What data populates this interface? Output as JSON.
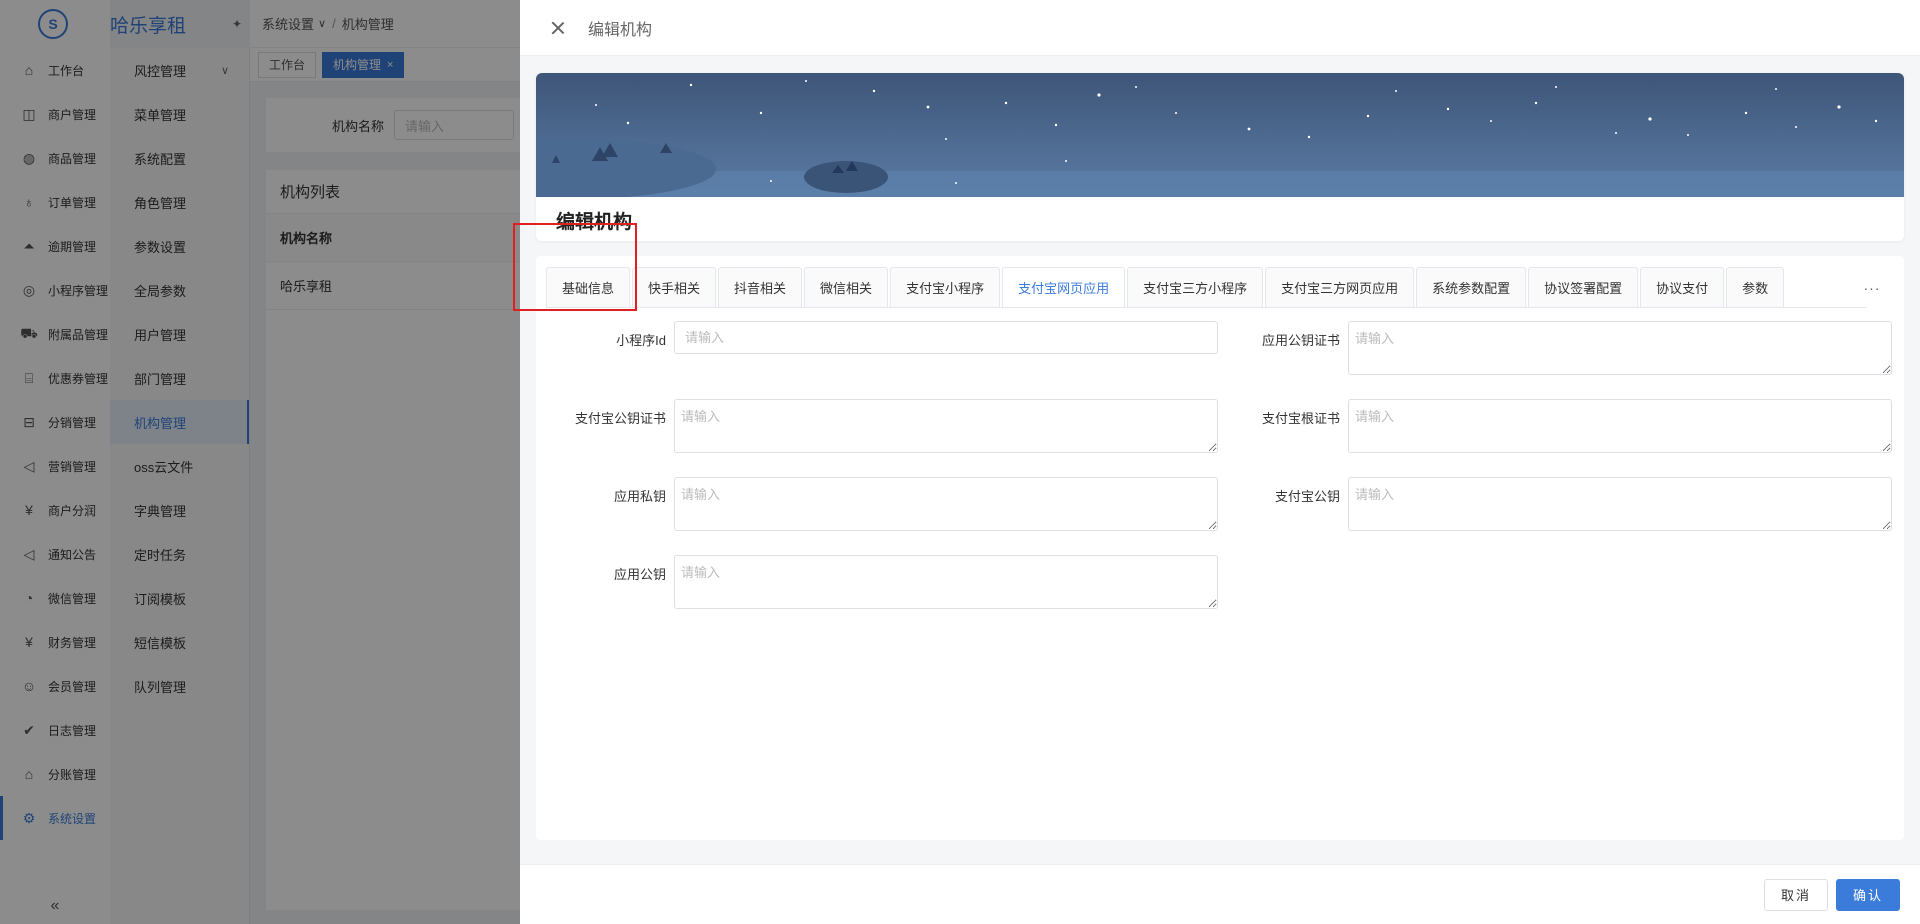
{
  "app": {
    "brand": "哈乐享租",
    "logo_glyph": "S",
    "sidebar": [
      {
        "label": "工作台",
        "icon": "home-icon",
        "glyph": "⌂"
      },
      {
        "label": "商户管理",
        "icon": "shopping-bag-icon",
        "glyph": "◫"
      },
      {
        "label": "商品管理",
        "icon": "apple-icon",
        "glyph": "◍"
      },
      {
        "label": "订单管理",
        "icon": "trophy-icon",
        "glyph": "♁"
      },
      {
        "label": "逾期管理",
        "icon": "alarm-icon",
        "glyph": "⏶"
      },
      {
        "label": "小程序管理",
        "icon": "robot-icon",
        "glyph": "◎"
      },
      {
        "label": "附属品管理",
        "icon": "cart-icon",
        "glyph": "⛟"
      },
      {
        "label": "优惠券管理",
        "icon": "gift-icon",
        "glyph": "⌸"
      },
      {
        "label": "分销管理",
        "icon": "sliders-icon",
        "glyph": "⊟"
      },
      {
        "label": "营销管理",
        "icon": "megaphone-icon",
        "glyph": "◁"
      },
      {
        "label": "商户分润",
        "icon": "yen-circle-icon",
        "glyph": "¥"
      },
      {
        "label": "通知公告",
        "icon": "notification-icon",
        "glyph": "◁"
      },
      {
        "label": "微信管理",
        "icon": "wechat-icon",
        "glyph": "◔"
      },
      {
        "label": "财务管理",
        "icon": "finance-icon",
        "glyph": "¥"
      },
      {
        "label": "会员管理",
        "icon": "users-icon",
        "glyph": "☺"
      },
      {
        "label": "日志管理",
        "icon": "shield-check-icon",
        "glyph": "✔"
      },
      {
        "label": "分账管理",
        "icon": "house-split-icon",
        "glyph": "⌂"
      },
      {
        "label": "系统设置",
        "icon": "gear-icon",
        "glyph": "⚙",
        "active": true
      }
    ],
    "collapse_glyph": "«",
    "subnav": [
      {
        "label": "风控管理",
        "caret": "∨"
      },
      {
        "label": "菜单管理"
      },
      {
        "label": "系统配置"
      },
      {
        "label": "角色管理"
      },
      {
        "label": "参数设置"
      },
      {
        "label": "全局参数"
      },
      {
        "label": "用户管理"
      },
      {
        "label": "部门管理"
      },
      {
        "label": "机构管理",
        "active": true
      },
      {
        "label": "oss云文件"
      },
      {
        "label": "字典管理"
      },
      {
        "label": "定时任务"
      },
      {
        "label": "订阅模板"
      },
      {
        "label": "短信模板"
      },
      {
        "label": "队列管理"
      }
    ],
    "pin_glyph": "✦",
    "breadcrumb": {
      "first": "系统设置",
      "caret": "∨",
      "sep": "/",
      "second": "机构管理"
    },
    "tags": [
      {
        "label": "工作台"
      },
      {
        "label": "机构管理",
        "active": true,
        "close": "×"
      }
    ],
    "search": {
      "label": "机构名称",
      "placeholder": "请输入"
    },
    "list": {
      "title": "机构列表",
      "column": "机构名称",
      "row": "哈乐享租"
    }
  },
  "drawer": {
    "title": "编辑机构",
    "banner_title": "编辑机构",
    "tabs": [
      {
        "label": "基础信息"
      },
      {
        "label": "快手相关"
      },
      {
        "label": "抖音相关"
      },
      {
        "label": "微信相关"
      },
      {
        "label": "支付宝小程序"
      },
      {
        "label": "支付宝网页应用",
        "active": true
      },
      {
        "label": "支付宝三方小程序"
      },
      {
        "label": "支付宝三方网页应用"
      },
      {
        "label": "系统参数配置"
      },
      {
        "label": "协议签署配置"
      },
      {
        "label": "协议支付"
      },
      {
        "label": "参数"
      }
    ],
    "tabs_more": "···",
    "fields": {
      "mini_program_id": {
        "label": "小程序Id",
        "placeholder": "请输入"
      },
      "app_public_cert": {
        "label": "应用公钥证书",
        "placeholder": "请输入"
      },
      "alipay_public_cert": {
        "label": "支付宝公钥证书",
        "placeholder": "请输入"
      },
      "alipay_root_cert": {
        "label": "支付宝根证书",
        "placeholder": "请输入"
      },
      "app_private_key": {
        "label": "应用私钥",
        "placeholder": "请输入"
      },
      "alipay_public_key": {
        "label": "支付宝公钥",
        "placeholder": "请输入"
      },
      "app_public_key": {
        "label": "应用公钥",
        "placeholder": "请输入"
      }
    },
    "footer": {
      "cancel": "取消",
      "confirm": "确认"
    }
  },
  "colors": {
    "accent": "#3b7bd9",
    "highlight": "#e02020",
    "banner_sky": "#3f5b82"
  }
}
